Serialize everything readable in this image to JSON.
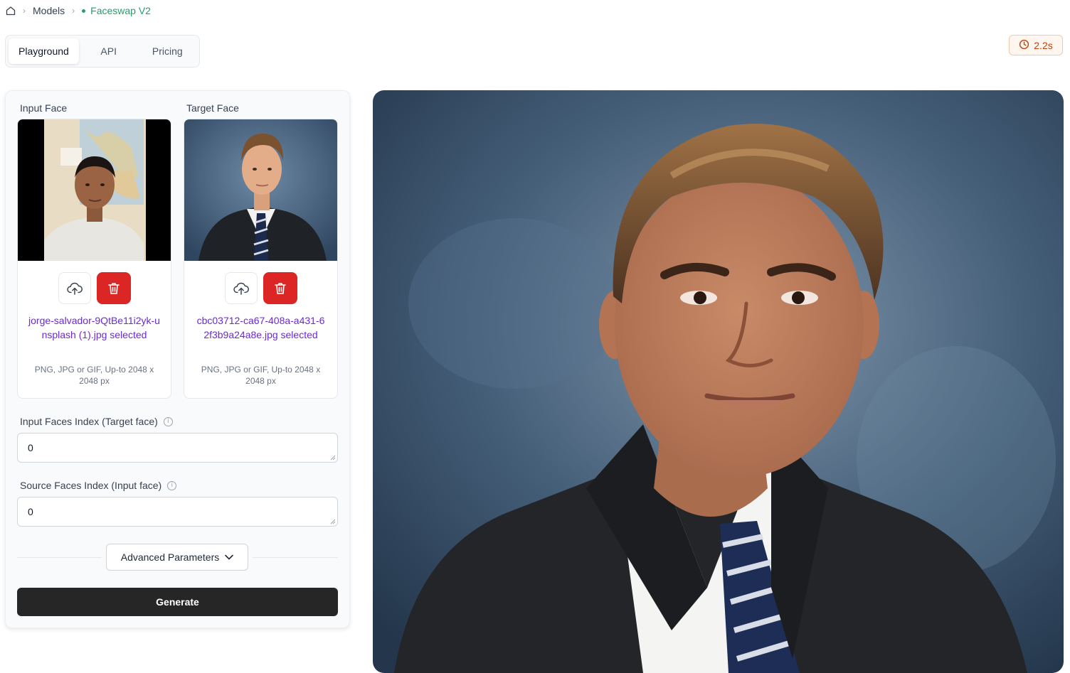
{
  "breadcrumb": {
    "home_icon": "home-icon",
    "models": "Models",
    "current": "Faceswap V2",
    "accent": "#22a06b"
  },
  "tabs": [
    {
      "label": "Playground",
      "active": true
    },
    {
      "label": "API",
      "active": false
    },
    {
      "label": "Pricing",
      "active": false
    }
  ],
  "timer": {
    "value": "2.2s",
    "color": "#c2410c",
    "icon": "clock-icon"
  },
  "input_face": {
    "label": "Input Face",
    "filename": "jorge-salvador-9QtBe11i2yk-unsplash (1).jpg selected",
    "hint": "PNG, JPG or GIF, Up-to 2048 x 2048 px"
  },
  "target_face": {
    "label": "Target Face",
    "filename": "cbc03712-ca67-408a-a431-62f3b9a24a8e.jpg selected",
    "hint": "PNG, JPG or GIF, Up-to 2048 x 2048 px"
  },
  "fields": {
    "input_faces_index": {
      "label": "Input Faces Index (Target face)",
      "value": "0"
    },
    "source_faces_index": {
      "label": "Source Faces Index (Input face)",
      "value": "0"
    }
  },
  "advanced": {
    "label": "Advanced Parameters"
  },
  "generate": {
    "label": "Generate"
  },
  "colors": {
    "delete": "#dc2626",
    "filename": "#6d28d9",
    "generate_bg": "#262626"
  }
}
